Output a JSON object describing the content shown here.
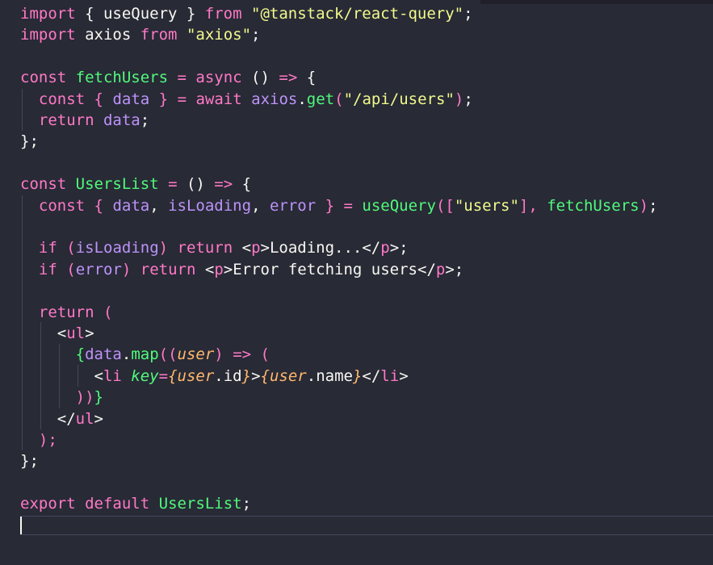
{
  "editor": {
    "language": "jsx",
    "theme_colors": {
      "background": "#282a36",
      "keyword": "#ff79c6",
      "string": "#f1fa8c",
      "function": "#50fa7b",
      "variable": "#bd93f9",
      "plain": "#f8f8f2",
      "parameter": "#ffb86c"
    },
    "lines": [
      [
        {
          "t": "import",
          "c": "kw"
        },
        {
          "t": " { useQuery } ",
          "c": "plain"
        },
        {
          "t": "from",
          "c": "kw"
        },
        {
          "t": " ",
          "c": "plain"
        },
        {
          "t": "\"@tanstack/react-query\"",
          "c": "str"
        },
        {
          "t": ";",
          "c": "plain"
        }
      ],
      [
        {
          "t": "import",
          "c": "kw"
        },
        {
          "t": " axios ",
          "c": "plain"
        },
        {
          "t": "from",
          "c": "kw"
        },
        {
          "t": " ",
          "c": "plain"
        },
        {
          "t": "\"axios\"",
          "c": "str"
        },
        {
          "t": ";",
          "c": "plain"
        }
      ],
      [],
      [
        {
          "t": "const",
          "c": "kw"
        },
        {
          "t": " ",
          "c": "plain"
        },
        {
          "t": "fetchUsers",
          "c": "fn"
        },
        {
          "t": " ",
          "c": "plain"
        },
        {
          "t": "=",
          "c": "kw"
        },
        {
          "t": " ",
          "c": "plain"
        },
        {
          "t": "async",
          "c": "kw"
        },
        {
          "t": " () ",
          "c": "plain"
        },
        {
          "t": "=>",
          "c": "kw"
        },
        {
          "t": " {",
          "c": "plain"
        }
      ],
      [
        {
          "t": "  ",
          "c": "plain"
        },
        {
          "t": "const",
          "c": "kw"
        },
        {
          "t": " ",
          "c": "plain"
        },
        {
          "t": "{",
          "c": "kw"
        },
        {
          "t": " ",
          "c": "plain"
        },
        {
          "t": "data",
          "c": "var"
        },
        {
          "t": " ",
          "c": "plain"
        },
        {
          "t": "}",
          "c": "kw"
        },
        {
          "t": " ",
          "c": "plain"
        },
        {
          "t": "=",
          "c": "kw"
        },
        {
          "t": " ",
          "c": "plain"
        },
        {
          "t": "await",
          "c": "kw"
        },
        {
          "t": " ",
          "c": "plain"
        },
        {
          "t": "axios",
          "c": "var"
        },
        {
          "t": ".",
          "c": "plain"
        },
        {
          "t": "get",
          "c": "fn"
        },
        {
          "t": "(",
          "c": "kw"
        },
        {
          "t": "\"/api/users\"",
          "c": "str"
        },
        {
          "t": ")",
          "c": "kw"
        },
        {
          "t": ";",
          "c": "plain"
        }
      ],
      [
        {
          "t": "  ",
          "c": "plain"
        },
        {
          "t": "return",
          "c": "kw"
        },
        {
          "t": " ",
          "c": "plain"
        },
        {
          "t": "data",
          "c": "var"
        },
        {
          "t": ";",
          "c": "plain"
        }
      ],
      [
        {
          "t": "};",
          "c": "plain"
        }
      ],
      [],
      [
        {
          "t": "const",
          "c": "kw"
        },
        {
          "t": " ",
          "c": "plain"
        },
        {
          "t": "UsersList",
          "c": "fn"
        },
        {
          "t": " ",
          "c": "plain"
        },
        {
          "t": "=",
          "c": "kw"
        },
        {
          "t": " () ",
          "c": "plain"
        },
        {
          "t": "=>",
          "c": "kw"
        },
        {
          "t": " {",
          "c": "plain"
        }
      ],
      [
        {
          "t": "  ",
          "c": "plain"
        },
        {
          "t": "const",
          "c": "kw"
        },
        {
          "t": " ",
          "c": "plain"
        },
        {
          "t": "{",
          "c": "kw"
        },
        {
          "t": " ",
          "c": "plain"
        },
        {
          "t": "data",
          "c": "var"
        },
        {
          "t": ", ",
          "c": "plain"
        },
        {
          "t": "isLoading",
          "c": "var"
        },
        {
          "t": ", ",
          "c": "plain"
        },
        {
          "t": "error",
          "c": "var"
        },
        {
          "t": " ",
          "c": "plain"
        },
        {
          "t": "}",
          "c": "kw"
        },
        {
          "t": " ",
          "c": "plain"
        },
        {
          "t": "=",
          "c": "kw"
        },
        {
          "t": " ",
          "c": "plain"
        },
        {
          "t": "useQuery",
          "c": "fn"
        },
        {
          "t": "([",
          "c": "kw"
        },
        {
          "t": "\"users\"",
          "c": "str"
        },
        {
          "t": "], ",
          "c": "kw"
        },
        {
          "t": "fetchUsers",
          "c": "fn"
        },
        {
          "t": ")",
          "c": "kw"
        },
        {
          "t": ";",
          "c": "plain"
        }
      ],
      [],
      [
        {
          "t": "  ",
          "c": "plain"
        },
        {
          "t": "if",
          "c": "kw"
        },
        {
          "t": " ",
          "c": "plain"
        },
        {
          "t": "(",
          "c": "kw"
        },
        {
          "t": "isLoading",
          "c": "var"
        },
        {
          "t": ")",
          "c": "kw"
        },
        {
          "t": " ",
          "c": "plain"
        },
        {
          "t": "return",
          "c": "kw"
        },
        {
          "t": " <",
          "c": "plain"
        },
        {
          "t": "p",
          "c": "tag"
        },
        {
          "t": ">Loading...</",
          "c": "plain"
        },
        {
          "t": "p",
          "c": "tag"
        },
        {
          "t": ">;",
          "c": "plain"
        }
      ],
      [
        {
          "t": "  ",
          "c": "plain"
        },
        {
          "t": "if",
          "c": "kw"
        },
        {
          "t": " ",
          "c": "plain"
        },
        {
          "t": "(",
          "c": "kw"
        },
        {
          "t": "error",
          "c": "var"
        },
        {
          "t": ")",
          "c": "kw"
        },
        {
          "t": " ",
          "c": "plain"
        },
        {
          "t": "return",
          "c": "kw"
        },
        {
          "t": " <",
          "c": "plain"
        },
        {
          "t": "p",
          "c": "tag"
        },
        {
          "t": ">Error fetching users</",
          "c": "plain"
        },
        {
          "t": "p",
          "c": "tag"
        },
        {
          "t": ">;",
          "c": "plain"
        }
      ],
      [],
      [
        {
          "t": "  ",
          "c": "plain"
        },
        {
          "t": "return",
          "c": "kw"
        },
        {
          "t": " ",
          "c": "plain"
        },
        {
          "t": "(",
          "c": "kw"
        }
      ],
      [
        {
          "t": "    <",
          "c": "plain"
        },
        {
          "t": "ul",
          "c": "tag"
        },
        {
          "t": ">",
          "c": "plain"
        }
      ],
      [
        {
          "t": "      ",
          "c": "plain"
        },
        {
          "t": "{",
          "c": "fn"
        },
        {
          "t": "data",
          "c": "var"
        },
        {
          "t": ".",
          "c": "plain"
        },
        {
          "t": "map",
          "c": "fn"
        },
        {
          "t": "((",
          "c": "kw"
        },
        {
          "t": "user",
          "c": "param"
        },
        {
          "t": ")",
          "c": "kw"
        },
        {
          "t": " ",
          "c": "plain"
        },
        {
          "t": "=>",
          "c": "kw"
        },
        {
          "t": " ",
          "c": "plain"
        },
        {
          "t": "(",
          "c": "kw"
        }
      ],
      [
        {
          "t": "        <",
          "c": "plain"
        },
        {
          "t": "li",
          "c": "tag"
        },
        {
          "t": " ",
          "c": "plain"
        },
        {
          "t": "key",
          "c": "attr"
        },
        {
          "t": "=",
          "c": "kw"
        },
        {
          "t": "{",
          "c": "param"
        },
        {
          "t": "user",
          "c": "param"
        },
        {
          "t": ".id",
          "c": "plain"
        },
        {
          "t": "}",
          "c": "param"
        },
        {
          "t": ">",
          "c": "plain"
        },
        {
          "t": "{",
          "c": "param"
        },
        {
          "t": "user",
          "c": "param"
        },
        {
          "t": ".name",
          "c": "plain"
        },
        {
          "t": "}",
          "c": "param"
        },
        {
          "t": "</",
          "c": "plain"
        },
        {
          "t": "li",
          "c": "tag"
        },
        {
          "t": ">",
          "c": "plain"
        }
      ],
      [
        {
          "t": "      ",
          "c": "plain"
        },
        {
          "t": "))",
          "c": "kw"
        },
        {
          "t": "}",
          "c": "fn"
        }
      ],
      [
        {
          "t": "    </",
          "c": "plain"
        },
        {
          "t": "ul",
          "c": "tag"
        },
        {
          "t": ">",
          "c": "plain"
        }
      ],
      [
        {
          "t": "  ",
          "c": "plain"
        },
        {
          "t": ");",
          "c": "kw"
        }
      ],
      [
        {
          "t": "};",
          "c": "plain"
        }
      ],
      [],
      [
        {
          "t": "export",
          "c": "kw"
        },
        {
          "t": " ",
          "c": "plain"
        },
        {
          "t": "default",
          "c": "kw"
        },
        {
          "t": " ",
          "c": "plain"
        },
        {
          "t": "UsersList",
          "c": "fn"
        },
        {
          "t": ";",
          "c": "plain"
        }
      ],
      []
    ]
  }
}
